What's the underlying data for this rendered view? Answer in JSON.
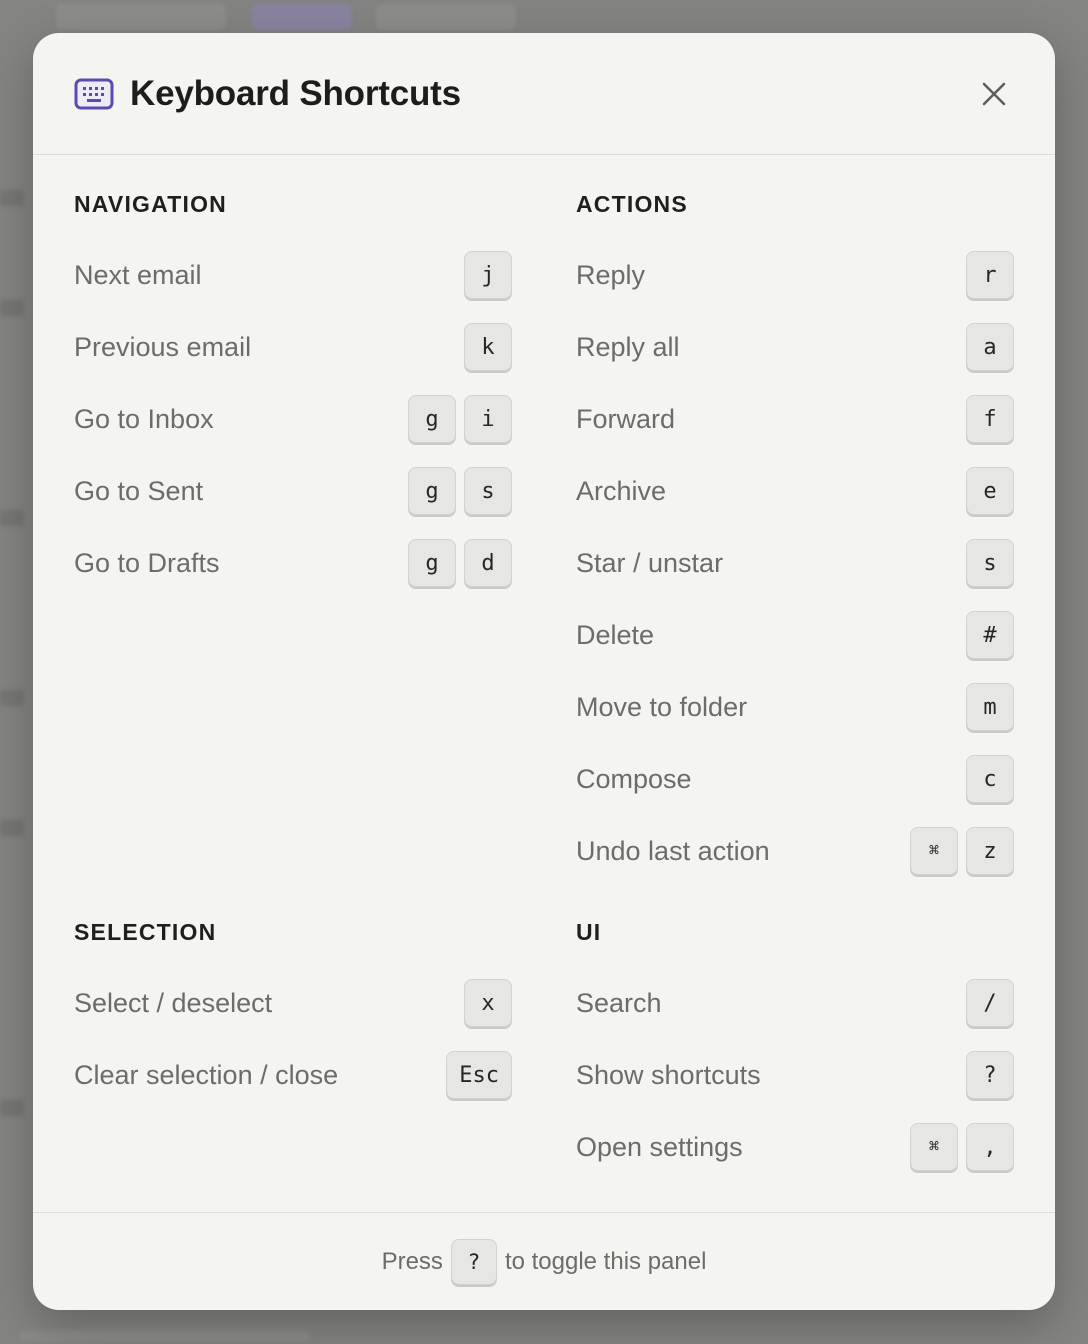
{
  "colors": {
    "accent": "#5b4bb0",
    "title": "#1d1d1b",
    "label": "#6c6c68",
    "panel": "#f4f4f1",
    "key_bg": "#e6e6e2"
  },
  "header": {
    "icon": "keyboard-icon",
    "title": "Keyboard Shortcuts",
    "close_icon": "close-icon"
  },
  "navigation": {
    "title": "NAVIGATION",
    "items": [
      {
        "label": "Next email",
        "keys": [
          "j"
        ]
      },
      {
        "label": "Previous email",
        "keys": [
          "k"
        ]
      },
      {
        "label": "Go to Inbox",
        "keys": [
          "g",
          "i"
        ]
      },
      {
        "label": "Go to Sent",
        "keys": [
          "g",
          "s"
        ]
      },
      {
        "label": "Go to Drafts",
        "keys": [
          "g",
          "d"
        ]
      }
    ]
  },
  "actions": {
    "title": "ACTIONS",
    "items": [
      {
        "label": "Reply",
        "keys": [
          "r"
        ]
      },
      {
        "label": "Reply all",
        "keys": [
          "a"
        ]
      },
      {
        "label": "Forward",
        "keys": [
          "f"
        ]
      },
      {
        "label": "Archive",
        "keys": [
          "e"
        ]
      },
      {
        "label": "Star / unstar",
        "keys": [
          "s"
        ]
      },
      {
        "label": "Delete",
        "keys": [
          "#"
        ]
      },
      {
        "label": "Move to folder",
        "keys": [
          "m"
        ]
      },
      {
        "label": "Compose",
        "keys": [
          "c"
        ]
      },
      {
        "label": "Undo last action",
        "keys": [
          "⌘",
          "z"
        ]
      }
    ]
  },
  "selection": {
    "title": "SELECTION",
    "items": [
      {
        "label": "Select / deselect",
        "keys": [
          "x"
        ]
      },
      {
        "label": "Clear selection / close",
        "keys": [
          "Esc"
        ]
      }
    ]
  },
  "ui": {
    "title": "UI",
    "items": [
      {
        "label": "Search",
        "keys": [
          "/"
        ]
      },
      {
        "label": "Show shortcuts",
        "keys": [
          "?"
        ]
      },
      {
        "label": "Open settings",
        "keys": [
          "⌘",
          ","
        ]
      }
    ]
  },
  "footer": {
    "before": "Press",
    "key": "?",
    "after": "to toggle this panel"
  }
}
